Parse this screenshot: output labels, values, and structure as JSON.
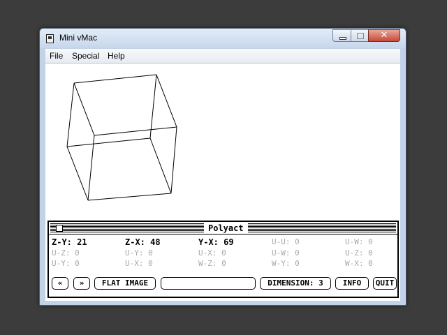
{
  "window": {
    "title": "Mini vMac",
    "close_glyph": "✕"
  },
  "menu": {
    "items": [
      "File",
      "Special",
      "Help"
    ]
  },
  "panel": {
    "title": "Polyact",
    "rows": [
      [
        {
          "text": "Z-Y: 21",
          "active": true
        },
        {
          "text": "Z-X: 48",
          "active": true
        },
        {
          "text": "Y-X: 69",
          "active": true
        },
        {
          "text": "U-U: 0",
          "active": false
        },
        {
          "text": "U-W: 0",
          "active": false
        }
      ],
      [
        {
          "text": "U-Z: 0",
          "active": false
        },
        {
          "text": "U-Y: 0",
          "active": false
        },
        {
          "text": "U-X: 0",
          "active": false
        },
        {
          "text": "U-W: 0",
          "active": false
        },
        {
          "text": "U-Z: 0",
          "active": false
        }
      ],
      [
        {
          "text": "U-Y: 0",
          "active": false
        },
        {
          "text": "U-X: 0",
          "active": false
        },
        {
          "text": "W-Z: 0",
          "active": false
        },
        {
          "text": "W-Y: 0",
          "active": false
        },
        {
          "text": "W-X: 0",
          "active": false
        }
      ]
    ],
    "buttons": {
      "back": "«",
      "forward": "»",
      "flat_image": "FLAT IMAGE",
      "blank": "",
      "dimension": "DIMENSION: 3",
      "info": "INFO",
      "quit": "QUIT"
    }
  }
}
